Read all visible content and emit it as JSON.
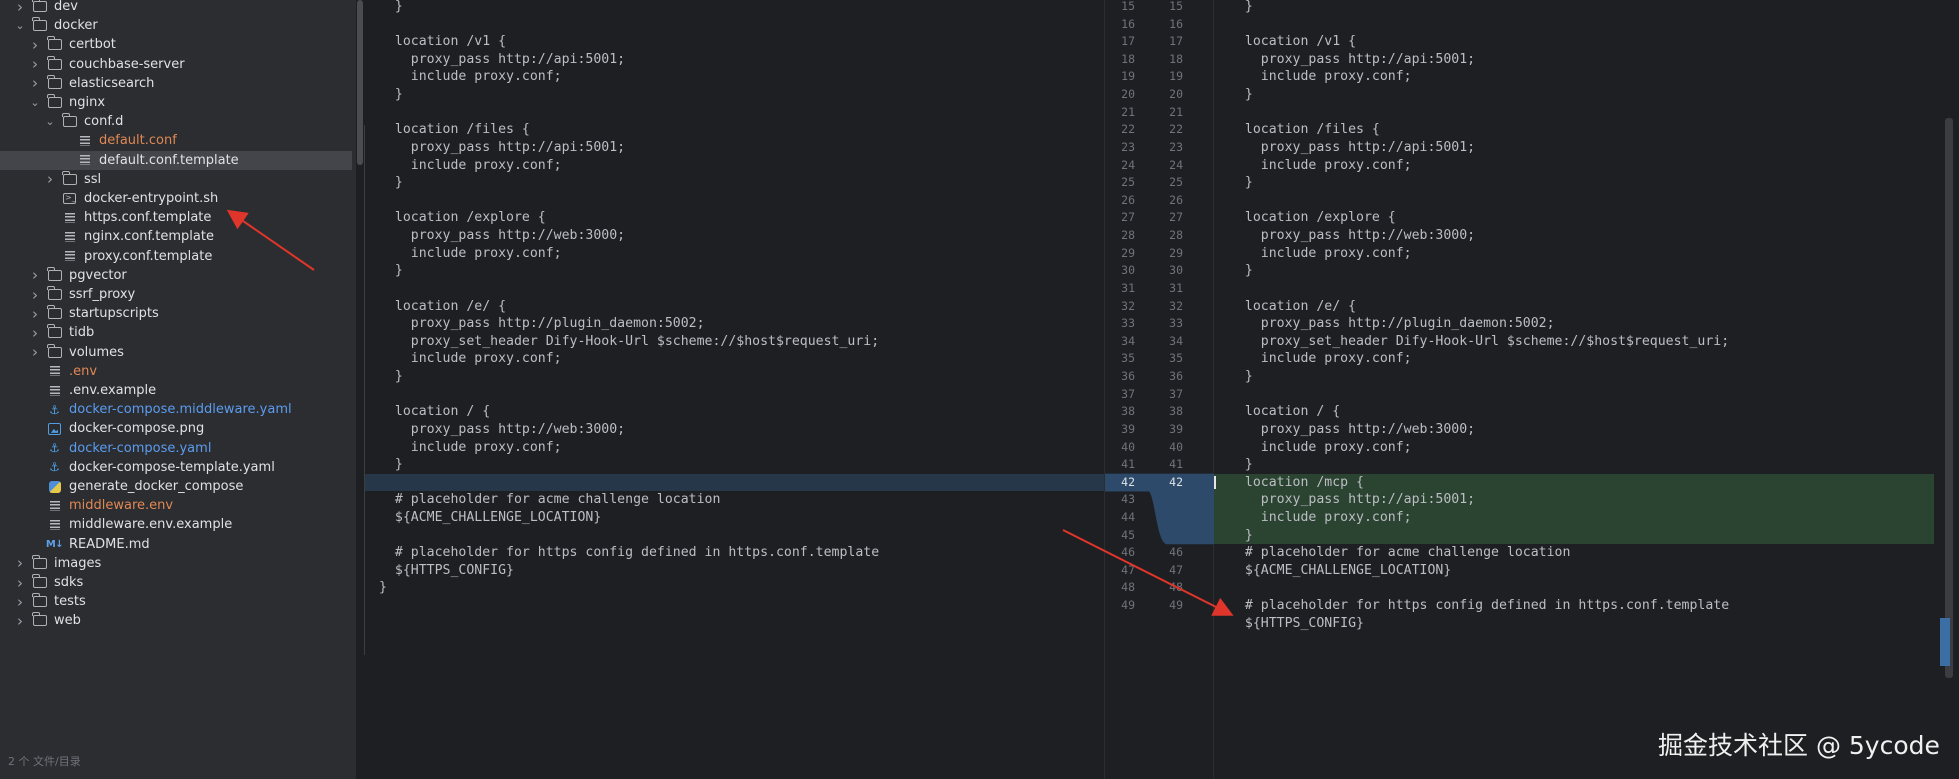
{
  "tree": {
    "items": [
      {
        "label": "dev",
        "kind": "folder",
        "depth": 1,
        "expanded": false,
        "color": "default"
      },
      {
        "label": "docker",
        "kind": "folder",
        "depth": 1,
        "expanded": true,
        "color": "default"
      },
      {
        "label": "certbot",
        "kind": "folder",
        "depth": 2,
        "expanded": false,
        "color": "default"
      },
      {
        "label": "couchbase-server",
        "kind": "folder",
        "depth": 2,
        "expanded": false,
        "color": "default"
      },
      {
        "label": "elasticsearch",
        "kind": "folder",
        "depth": 2,
        "expanded": false,
        "color": "default"
      },
      {
        "label": "nginx",
        "kind": "folder",
        "depth": 2,
        "expanded": true,
        "color": "default"
      },
      {
        "label": "conf.d",
        "kind": "folder",
        "depth": 3,
        "expanded": true,
        "color": "default"
      },
      {
        "label": "default.conf",
        "kind": "text",
        "depth": 4,
        "color": "orange"
      },
      {
        "label": "default.conf.template",
        "kind": "text",
        "depth": 4,
        "color": "default",
        "selected": true
      },
      {
        "label": "ssl",
        "kind": "folder",
        "depth": 3,
        "expanded": false,
        "color": "default"
      },
      {
        "label": "docker-entrypoint.sh",
        "kind": "shell",
        "depth": 3,
        "color": "default"
      },
      {
        "label": "https.conf.template",
        "kind": "text",
        "depth": 3,
        "color": "default"
      },
      {
        "label": "nginx.conf.template",
        "kind": "text",
        "depth": 3,
        "color": "default"
      },
      {
        "label": "proxy.conf.template",
        "kind": "text",
        "depth": 3,
        "color": "default"
      },
      {
        "label": "pgvector",
        "kind": "folder",
        "depth": 2,
        "expanded": false,
        "color": "default"
      },
      {
        "label": "ssrf_proxy",
        "kind": "folder",
        "depth": 2,
        "expanded": false,
        "color": "default"
      },
      {
        "label": "startupscripts",
        "kind": "folder",
        "depth": 2,
        "expanded": false,
        "color": "default"
      },
      {
        "label": "tidb",
        "kind": "folder",
        "depth": 2,
        "expanded": false,
        "color": "default"
      },
      {
        "label": "volumes",
        "kind": "folder",
        "depth": 2,
        "expanded": false,
        "color": "default"
      },
      {
        "label": ".env",
        "kind": "text",
        "depth": 2,
        "color": "orange"
      },
      {
        "label": ".env.example",
        "kind": "text",
        "depth": 2,
        "color": "default"
      },
      {
        "label": "docker-compose.middleware.yaml",
        "kind": "docker",
        "depth": 2,
        "color": "blue"
      },
      {
        "label": "docker-compose.png",
        "kind": "image",
        "depth": 2,
        "color": "default"
      },
      {
        "label": "docker-compose.yaml",
        "kind": "docker",
        "depth": 2,
        "color": "blue"
      },
      {
        "label": "docker-compose-template.yaml",
        "kind": "docker",
        "depth": 2,
        "color": "default"
      },
      {
        "label": "generate_docker_compose",
        "kind": "python",
        "depth": 2,
        "color": "default"
      },
      {
        "label": "middleware.env",
        "kind": "text",
        "depth": 2,
        "color": "orange"
      },
      {
        "label": "middleware.env.example",
        "kind": "text",
        "depth": 2,
        "color": "default"
      },
      {
        "label": "README.md",
        "kind": "markdown",
        "depth": 2,
        "color": "default"
      },
      {
        "label": "images",
        "kind": "folder",
        "depth": 1,
        "expanded": false,
        "color": "default"
      },
      {
        "label": "sdks",
        "kind": "folder",
        "depth": 1,
        "expanded": false,
        "color": "default"
      },
      {
        "label": "tests",
        "kind": "folder",
        "depth": 1,
        "expanded": false,
        "color": "default"
      },
      {
        "label": "web",
        "kind": "folder",
        "depth": 1,
        "expanded": false,
        "color": "default"
      }
    ],
    "icons": {
      "folder": "folder-icon",
      "text": "text-file-icon",
      "shell": "shell-script-icon",
      "image": "image-file-icon",
      "docker": "docker-icon",
      "python": "python-icon",
      "markdown": "markdown-icon"
    },
    "corner_label": "2 个 文件/目录"
  },
  "diff": {
    "left_lines": [
      {
        "n": 15,
        "text": "  }"
      },
      {
        "n": 16,
        "text": ""
      },
      {
        "n": 17,
        "text": "  location /v1 {"
      },
      {
        "n": 18,
        "text": "    proxy_pass http://api:5001;"
      },
      {
        "n": 19,
        "text": "    include proxy.conf;"
      },
      {
        "n": 20,
        "text": "  }"
      },
      {
        "n": 21,
        "text": ""
      },
      {
        "n": 22,
        "text": "  location /files {"
      },
      {
        "n": 23,
        "text": "    proxy_pass http://api:5001;"
      },
      {
        "n": 24,
        "text": "    include proxy.conf;"
      },
      {
        "n": 25,
        "text": "  }"
      },
      {
        "n": 26,
        "text": ""
      },
      {
        "n": 27,
        "text": "  location /explore {"
      },
      {
        "n": 28,
        "text": "    proxy_pass http://web:3000;"
      },
      {
        "n": 29,
        "text": "    include proxy.conf;"
      },
      {
        "n": 30,
        "text": "  }"
      },
      {
        "n": 31,
        "text": ""
      },
      {
        "n": 32,
        "text": "  location /e/ {"
      },
      {
        "n": 33,
        "text": "    proxy_pass http://plugin_daemon:5002;"
      },
      {
        "n": 34,
        "text": "    proxy_set_header Dify-Hook-Url $scheme://$host$request_uri;"
      },
      {
        "n": 35,
        "text": "    include proxy.conf;"
      },
      {
        "n": 36,
        "text": "  }"
      },
      {
        "n": 37,
        "text": ""
      },
      {
        "n": 38,
        "text": "  location / {"
      },
      {
        "n": 39,
        "text": "    proxy_pass http://web:3000;"
      },
      {
        "n": 40,
        "text": "    include proxy.conf;"
      },
      {
        "n": 41,
        "text": "  }"
      },
      {
        "n": 42,
        "text": ""
      },
      {
        "n": 43,
        "text": "  # placeholder for acme challenge location"
      },
      {
        "n": 44,
        "text": "  ${ACME_CHALLENGE_LOCATION}"
      },
      {
        "n": 45,
        "text": ""
      },
      {
        "n": 46,
        "text": "  # placeholder for https config defined in https.conf.template"
      },
      {
        "n": 47,
        "text": "  ${HTTPS_CONFIG}"
      },
      {
        "n": 48,
        "text": "}"
      },
      {
        "n": 49,
        "text": ""
      }
    ],
    "right_lines": [
      {
        "n": 15,
        "text": "  }"
      },
      {
        "n": 16,
        "text": ""
      },
      {
        "n": 17,
        "text": "  location /v1 {"
      },
      {
        "n": 18,
        "text": "    proxy_pass http://api:5001;"
      },
      {
        "n": 19,
        "text": "    include proxy.conf;"
      },
      {
        "n": 20,
        "text": "  }"
      },
      {
        "n": 21,
        "text": ""
      },
      {
        "n": 22,
        "text": "  location /files {"
      },
      {
        "n": 23,
        "text": "    proxy_pass http://api:5001;"
      },
      {
        "n": 24,
        "text": "    include proxy.conf;"
      },
      {
        "n": 25,
        "text": "  }"
      },
      {
        "n": 26,
        "text": ""
      },
      {
        "n": 27,
        "text": "  location /explore {"
      },
      {
        "n": 28,
        "text": "    proxy_pass http://web:3000;"
      },
      {
        "n": 29,
        "text": "    include proxy.conf;"
      },
      {
        "n": 30,
        "text": "  }"
      },
      {
        "n": 31,
        "text": ""
      },
      {
        "n": 32,
        "text": "  location /e/ {"
      },
      {
        "n": 33,
        "text": "    proxy_pass http://plugin_daemon:5002;"
      },
      {
        "n": 34,
        "text": "    proxy_set_header Dify-Hook-Url $scheme://$host$request_uri;"
      },
      {
        "n": 35,
        "text": "    include proxy.conf;"
      },
      {
        "n": 36,
        "text": "  }"
      },
      {
        "n": 37,
        "text": ""
      },
      {
        "n": 38,
        "text": "  location / {"
      },
      {
        "n": 39,
        "text": "    proxy_pass http://web:3000;"
      },
      {
        "n": 40,
        "text": "    include proxy.conf;"
      },
      {
        "n": 41,
        "text": "  }"
      },
      {
        "n": 42,
        "text": "  location /mcp {",
        "added": true
      },
      {
        "n": "",
        "text": "    proxy_pass http://api:5001;",
        "added": true
      },
      {
        "n": "",
        "text": "    include proxy.conf;",
        "added": true
      },
      {
        "n": "",
        "text": "  }",
        "added": true
      },
      {
        "n": 46,
        "text": "  # placeholder for acme challenge location"
      },
      {
        "n": 47,
        "text": "  ${ACME_CHALLENGE_LOCATION}"
      },
      {
        "n": 48,
        "text": ""
      },
      {
        "n": 49,
        "text": "  # placeholder for https config defined in https.conf.template"
      },
      {
        "n": "",
        "text": "  ${HTTPS_CONFIG}"
      }
    ],
    "gutter_left": [
      15,
      16,
      17,
      18,
      19,
      20,
      21,
      22,
      23,
      24,
      25,
      26,
      27,
      28,
      29,
      30,
      31,
      32,
      33,
      34,
      35,
      36,
      37,
      38,
      39,
      40,
      41,
      42,
      43,
      44,
      45,
      46,
      47,
      48,
      49
    ],
    "gutter_right": [
      15,
      16,
      17,
      18,
      19,
      20,
      21,
      22,
      23,
      24,
      25,
      26,
      27,
      28,
      29,
      30,
      31,
      32,
      33,
      34,
      35,
      36,
      37,
      38,
      39,
      40,
      41,
      42,
      "",
      "",
      "",
      46,
      47,
      48,
      49
    ],
    "highlight_line": 42
  },
  "watermark": "掘金技术社区 @ 5ycode",
  "colors": {
    "added_bg": "#2b4331",
    "changed_bg": "#253748",
    "arrow": "#e0352b"
  }
}
